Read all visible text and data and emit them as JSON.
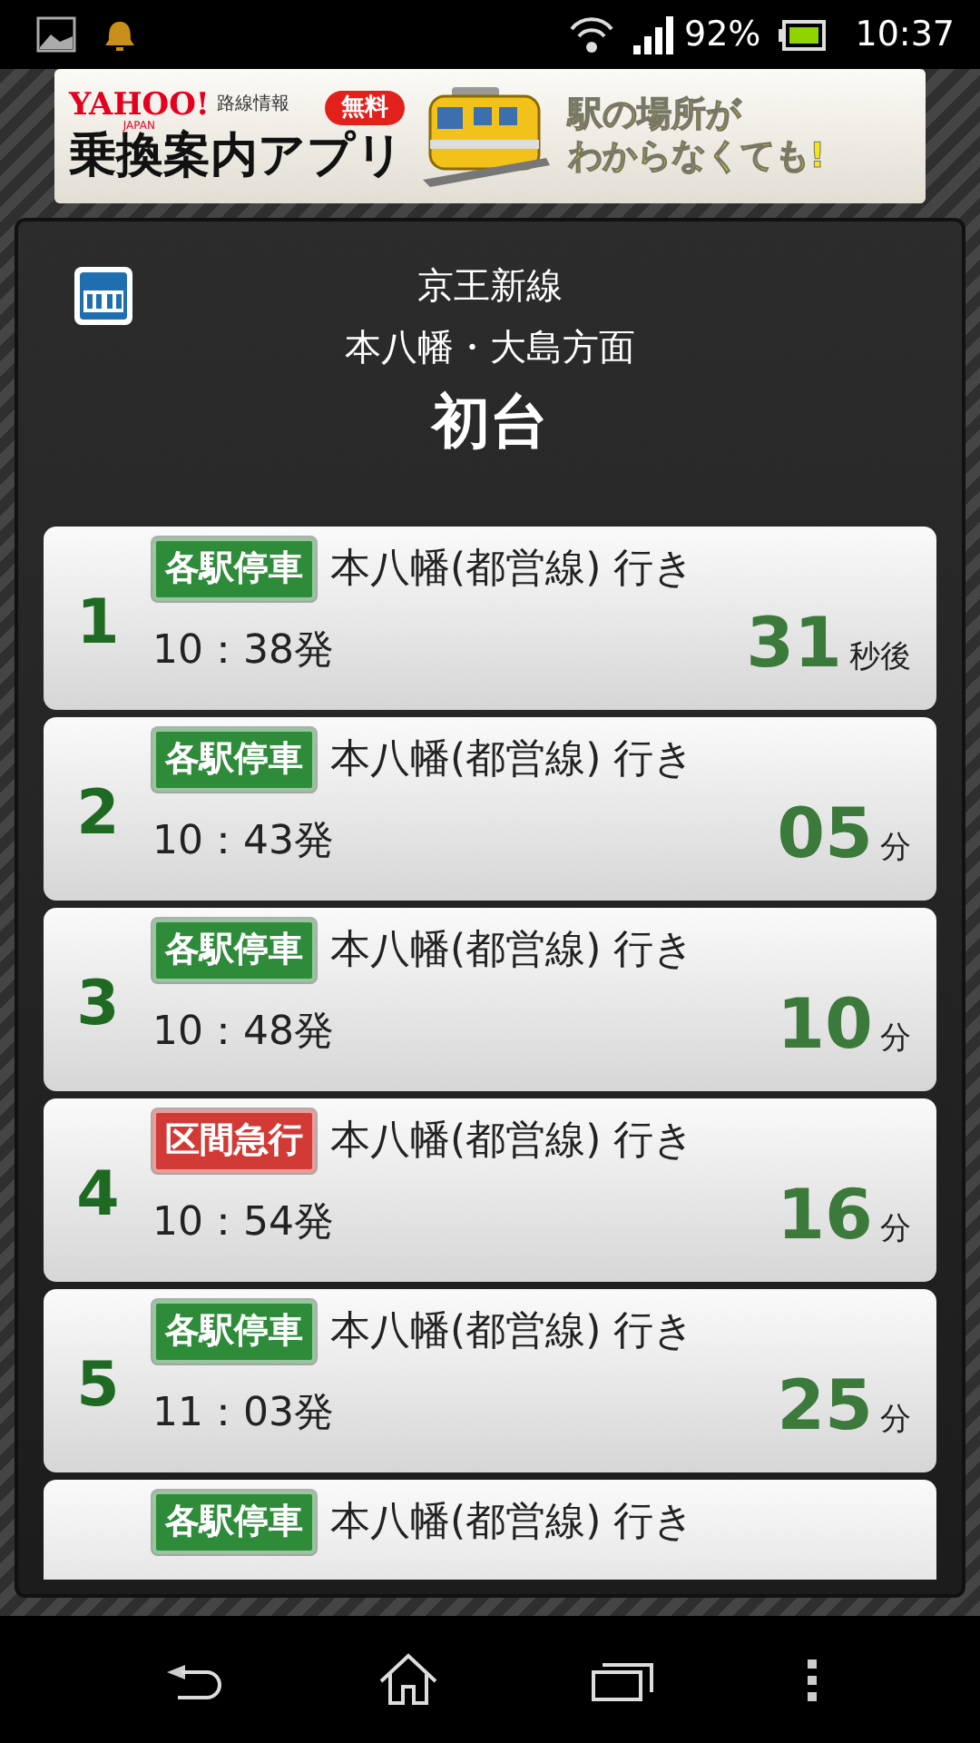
{
  "status_bar": {
    "battery": "92%",
    "time": "10:37"
  },
  "ad_banner": {
    "brand": "YAHOO!",
    "brand_sub": "JAPAN",
    "service": "路線情報",
    "badge": "無料",
    "title": "乗換案内アプリ",
    "tagline": [
      "駅の場所が",
      "わからなくても!"
    ]
  },
  "header": {
    "line": "京王新線",
    "direction": "本八幡・大島方面",
    "station": "初台"
  },
  "departures": [
    {
      "number": "1",
      "type": "各駅停車",
      "color": "#2e8b3a",
      "destination": "本八幡(都営線) 行き",
      "time": "10：38発",
      "remaining": "31",
      "unit": "秒後"
    },
    {
      "number": "2",
      "type": "各駅停車",
      "color": "#2e8b3a",
      "destination": "本八幡(都営線) 行き",
      "time": "10：43発",
      "remaining": "05",
      "unit": "分"
    },
    {
      "number": "3",
      "type": "各駅停車",
      "color": "#2e8b3a",
      "destination": "本八幡(都営線) 行き",
      "time": "10：48発",
      "remaining": "10",
      "unit": "分"
    },
    {
      "number": "4",
      "type": "区間急行",
      "color": "#d23a36",
      "destination": "本八幡(都営線) 行き",
      "time": "10：54発",
      "remaining": "16",
      "unit": "分"
    },
    {
      "number": "5",
      "type": "各駅停車",
      "color": "#2e8b3a",
      "destination": "本八幡(都営線) 行き",
      "time": "11：03発",
      "remaining": "25",
      "unit": "分"
    },
    {
      "type": "各駅停車",
      "color": "#2e8b3a",
      "destination": "本八幡(都営線) 行き"
    }
  ]
}
